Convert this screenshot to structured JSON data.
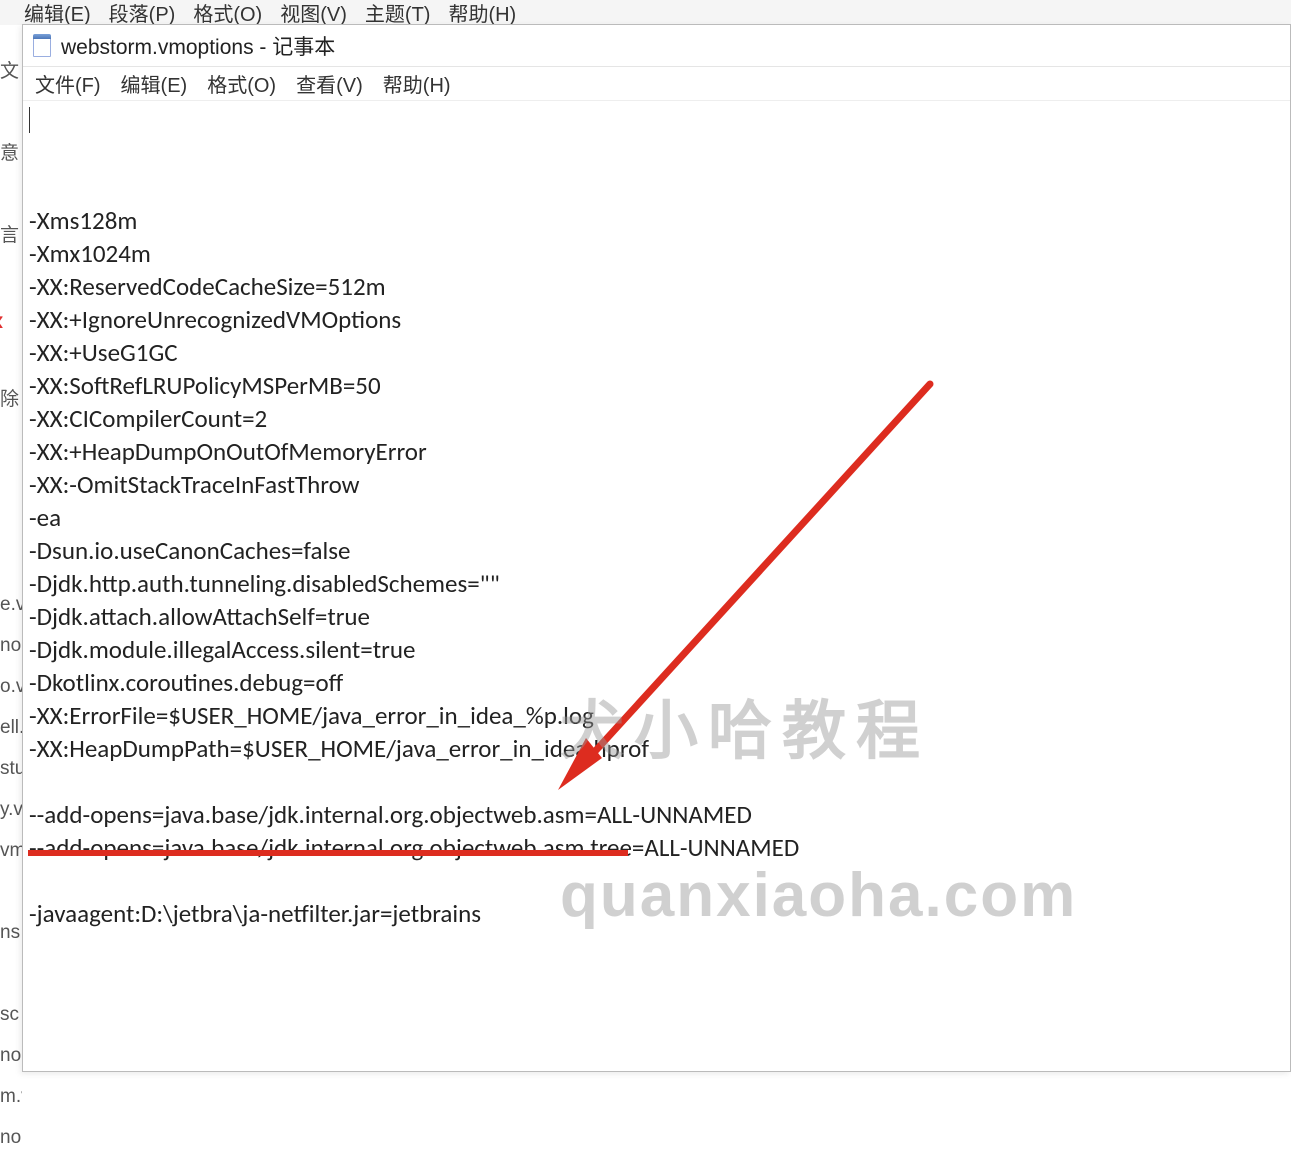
{
  "bg_menu": [
    "编辑(E)",
    "段落(P)",
    "格式(O)",
    "视图(V)",
    "主题(T)",
    "帮助(H)"
  ],
  "bg_left": [
    "文",
    "",
    "意",
    "",
    "言",
    "",
    "",
    "",
    "除",
    "",
    "",
    "",
    "",
    "e.v",
    "no",
    "o.v",
    "ell.",
    "stu",
    "y.v",
    "vm",
    "",
    "ns",
    "",
    "sc",
    "no",
    "m.v",
    "no"
  ],
  "title": "webstorm.vmoptions - 记事本",
  "np_menu": [
    "文件(F)",
    "编辑(E)",
    "格式(O)",
    "查看(V)",
    "帮助(H)"
  ],
  "lines": [
    "-Xms128m",
    "-Xmx1024m",
    "-XX:ReservedCodeCacheSize=512m",
    "-XX:+IgnoreUnrecognizedVMOptions",
    "-XX:+UseG1GC",
    "-XX:SoftRefLRUPolicyMSPerMB=50",
    "-XX:CICompilerCount=2",
    "-XX:+HeapDumpOnOutOfMemoryError",
    "-XX:-OmitStackTraceInFastThrow",
    "-ea",
    "-Dsun.io.useCanonCaches=false",
    "-Djdk.http.auth.tunneling.disabledSchemes=\"\"",
    "-Djdk.attach.allowAttachSelf=true",
    "-Djdk.module.illegalAccess.silent=true",
    "-Dkotlinx.coroutines.debug=off",
    "-XX:ErrorFile=$USER_HOME/java_error_in_idea_%p.log",
    "-XX:HeapDumpPath=$USER_HOME/java_error_in_idea.hprof",
    "",
    "--add-opens=java.base/jdk.internal.org.objectweb.asm=ALL-UNNAMED",
    "--add-opens=java.base/jdk.internal.org.objectweb.asm.tree=ALL-UNNAMED",
    "",
    "-javaagent:D:\\jetbra\\ja-netfilter.jar=jetbrains"
  ],
  "watermark_cn": "犬小哈教程",
  "watermark_en": "quanxiaoha.com",
  "colors": {
    "arrow": "#dd2c1f"
  }
}
